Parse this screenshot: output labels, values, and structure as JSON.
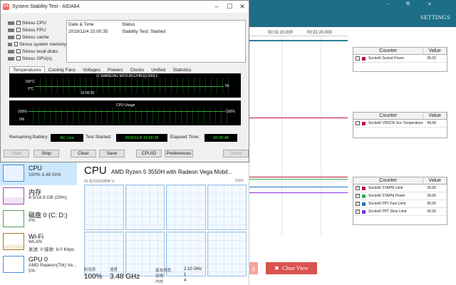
{
  "background_app": {
    "settings_label": "SETTINGS",
    "window_controls": [
      "–",
      "⧉",
      "✕"
    ],
    "time_labels": [
      "00:31:10,000",
      "00:31:20,000"
    ],
    "tables": [
      {
        "header": [
          "Counter",
          "Value"
        ],
        "rows": [
          {
            "label": "Socket0 Socket Power",
            "value": "35.03",
            "color": "#c0143c",
            "checked": false
          }
        ]
      },
      {
        "header": [
          "Counter",
          "Value"
        ],
        "rows": [
          {
            "label": "Socket0 VDDCR Soc Temperature",
            "value": "69.58",
            "color": "#c0143c",
            "checked": false
          }
        ]
      },
      {
        "header": [
          "Counter",
          "Value"
        ],
        "rows": [
          {
            "label": "Socket0 STAPM Limit",
            "value": "35.00",
            "color": "#c0143c",
            "checked": true
          },
          {
            "label": "Socket0 STAPM Power",
            "value": "35.00",
            "color": "#2db34a",
            "checked": true
          },
          {
            "label": "Socket0 PPT Fast Limit",
            "value": "50.00",
            "color": "#1f78c8",
            "checked": true
          },
          {
            "label": "Socket0 PPT Slow Limit",
            "value": "42.00",
            "color": "#8a2be2",
            "checked": true
          }
        ]
      }
    ],
    "close_view_label": "Close View",
    "close_view_icon": "✖",
    "partial_button_text": "g"
  },
  "aida": {
    "title": "System Stability Test - AIDA64",
    "window_controls": [
      "–",
      "☐",
      "✕"
    ],
    "stress_items": [
      {
        "label": "Stress CPU",
        "checked": true
      },
      {
        "label": "Stress FPU",
        "checked": false
      },
      {
        "label": "Stress cache",
        "checked": false
      },
      {
        "label": "Stress system memory",
        "checked": false
      },
      {
        "label": "Stress local disks",
        "checked": false
      },
      {
        "label": "Stress GPU(s)",
        "checked": false
      }
    ],
    "info_headers": [
      "Date & Time",
      "Status"
    ],
    "info_values": [
      "2019/11/4 15:00:35",
      "Stability Test: Started"
    ],
    "tabs": [
      "Temperatures",
      "Cooling Fans",
      "Voltages",
      "Powers",
      "Clocks",
      "Unified",
      "Statistics"
    ],
    "temp_graph": {
      "legend": "SAMSUNG MZVLB512HBJQ-000L2",
      "top_label": "100°C",
      "bottom_label": "0°C",
      "time": "15:00:35",
      "current": "50"
    },
    "cpu_graph": {
      "title": "CPU Usage",
      "top_left": "100%",
      "bottom_left": "0%",
      "top_right": "100%"
    },
    "status": {
      "battery_label": "Remaining Battery:",
      "battery_value": "AC Line",
      "started_label": "Test Started:",
      "started_value": "2019/11/4 15:00:35",
      "elapsed_label": "Elapsed Time:",
      "elapsed_value": "00:00:48"
    },
    "buttons": {
      "start": "Start",
      "stop": "Stop",
      "clear": "Clear",
      "save": "Save",
      "cpuid": "CPUID",
      "preferences": "Preferences",
      "close": "Close"
    }
  },
  "taskmgr": {
    "sidebar": [
      {
        "name": "CPU",
        "line1": "100%  3.48 GHz",
        "line2": ""
      },
      {
        "name": "内存",
        "line1": "4.3/14.9 GB (29%)",
        "line2": ""
      },
      {
        "name": "磁盘 0 (C: D:)",
        "line1": "0%",
        "line2": ""
      },
      {
        "name": "Wi-Fi",
        "line1": "WLAN",
        "line2": "发送: 0  接收: 8.0 Kbps"
      },
      {
        "name": "GPU 0",
        "line1": "AMD Radeon(TM) Ve...",
        "line2": "5%"
      }
    ],
    "title": "CPU",
    "model": "AMD Ryzen 5 3550H with Radeon Vega Mobil...",
    "caption_left": "60 秒内的利用率 %",
    "caption_right": "100%",
    "stats": {
      "util_label": "利用率",
      "util_value": "100%",
      "speed_label": "速度",
      "speed_value": "3.48 GHz",
      "base_label": "基准速度:",
      "base_value": "2.10 GHz",
      "sockets_label": "插槽:",
      "sockets_value": "1",
      "cores_label": "内核:",
      "cores_value": "4"
    }
  }
}
